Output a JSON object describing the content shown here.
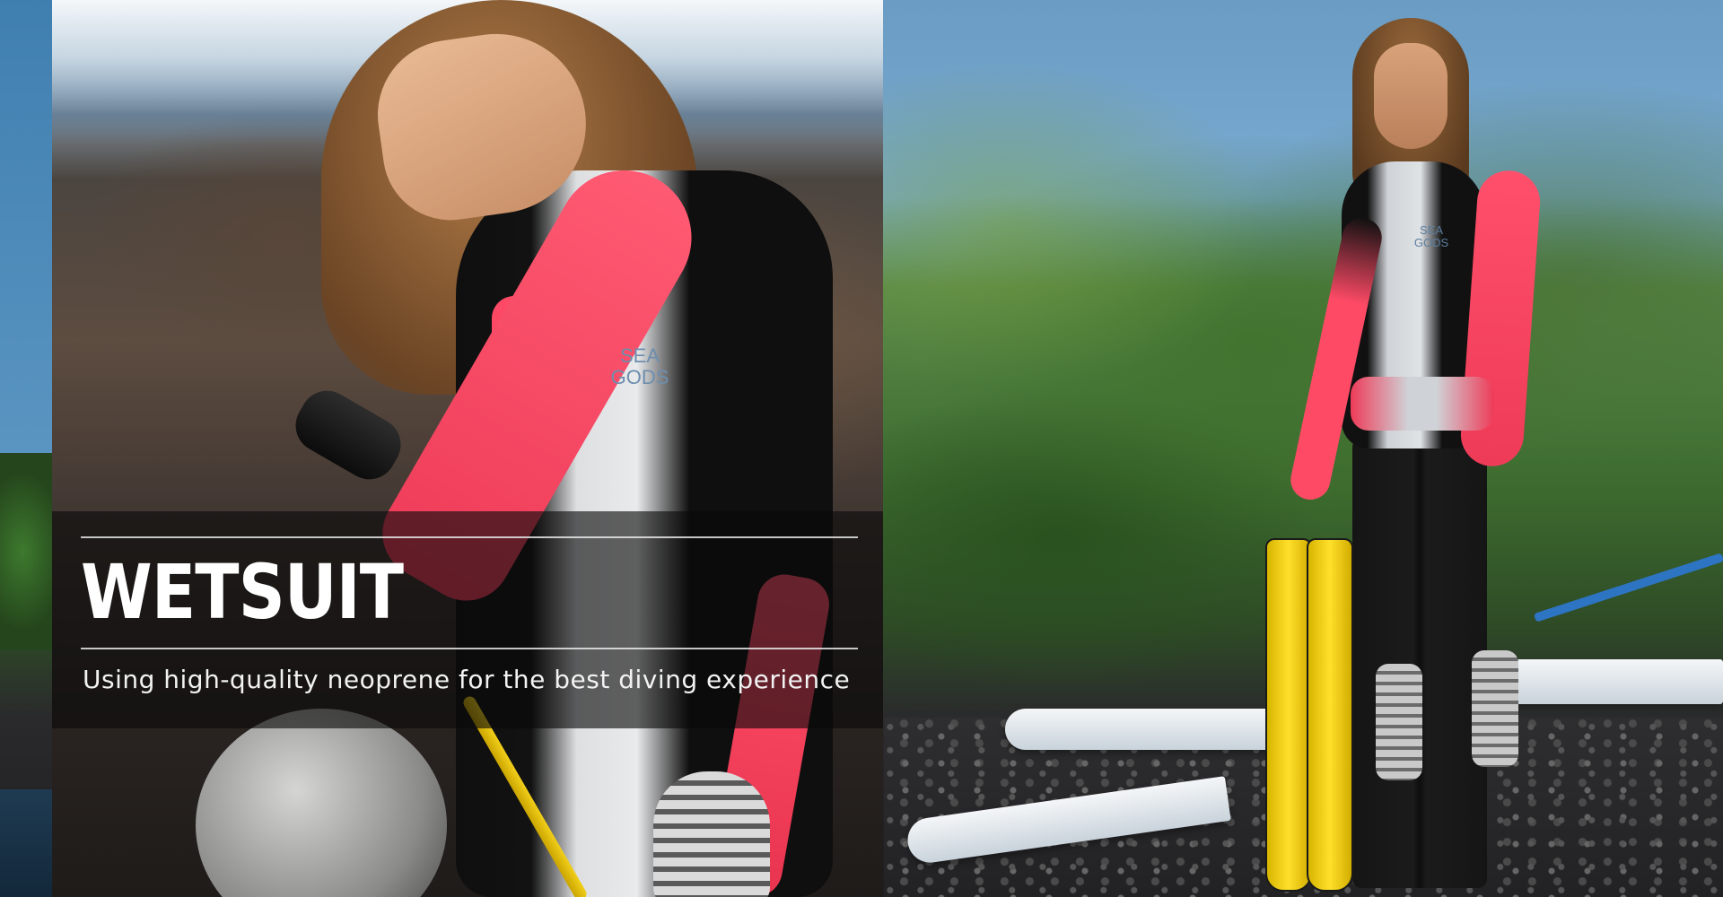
{
  "banner": {
    "title": "WETSUIT",
    "subtitle": "Using high-quality neoprene for the best diving experience"
  },
  "photos": {
    "left": {
      "chest_logo": "SEA GODS"
    },
    "right": {
      "chest_logo": "SEA GODS"
    }
  },
  "colors": {
    "overlay": "#0a0a0a",
    "text": "#ffffff",
    "suit_pink": "#ff4a66",
    "suit_black": "#111111",
    "suit_gray": "#dedfe1",
    "fin_yellow": "#ffe02a"
  }
}
